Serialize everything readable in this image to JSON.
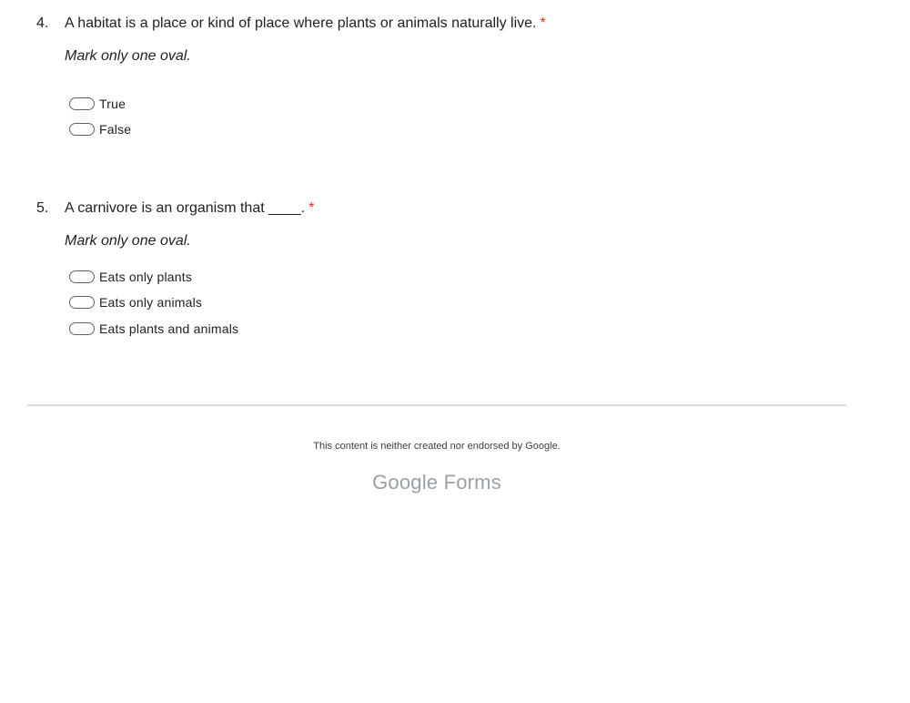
{
  "questions": [
    {
      "number": "4.",
      "title": "A habitat is a place or kind of place where plants or animals naturally live.",
      "required_marker": "*",
      "instruction": "Mark only one oval.",
      "options": [
        "True",
        "False"
      ]
    },
    {
      "number": "5.",
      "title": "A carnivore is an organism that ____.",
      "required_marker": "*",
      "instruction": "Mark only one oval.",
      "options": [
        "Eats only plants",
        "Eats only animals",
        "Eats plants and animals"
      ]
    }
  ],
  "footer": {
    "disclaimer": "This content is neither created nor endorsed by Google.",
    "brand_google": "Google",
    "brand_forms": "Forms"
  },
  "colors": {
    "required": "#d93025",
    "divider": "#dadce0",
    "brand": "#9aa0a6"
  }
}
